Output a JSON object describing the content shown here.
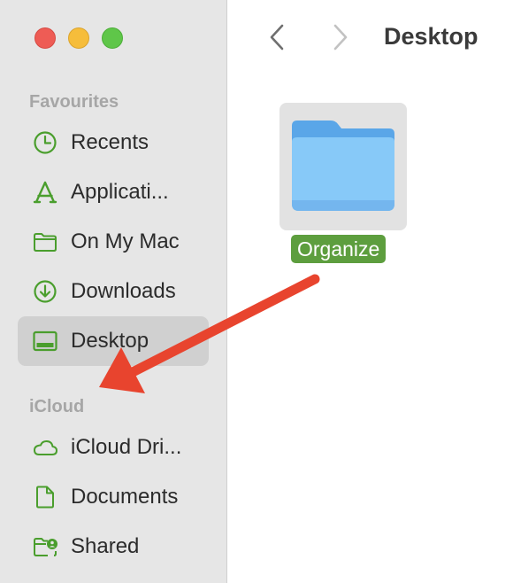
{
  "window": {
    "title": "Desktop",
    "traffic_lights": {
      "close": "#ee5c55",
      "minimize": "#f6bd3b",
      "zoom": "#5fc649"
    }
  },
  "colors": {
    "sidebar_icon": "#4a9e2d",
    "selection": "#d0d0d0",
    "folder": "#7ec4f7",
    "rename_highlight": "#5d9e3e",
    "annotation_arrow": "#e8442e"
  },
  "sidebar": {
    "favourites_label": "Favourites",
    "favourites": [
      {
        "label": "Recents",
        "icon": "clock-icon"
      },
      {
        "label": "Applicati...",
        "icon": "applications-icon"
      },
      {
        "label": "On My Mac",
        "icon": "folder-icon"
      },
      {
        "label": "Downloads",
        "icon": "download-icon"
      },
      {
        "label": "Desktop",
        "icon": "desktop-icon",
        "selected": true
      }
    ],
    "icloud_label": "iCloud",
    "icloud": [
      {
        "label": "iCloud Dri...",
        "icon": "cloud-icon"
      },
      {
        "label": "Documents",
        "icon": "document-icon"
      },
      {
        "label": "Shared",
        "icon": "shared-folder-icon"
      }
    ]
  },
  "content": {
    "items": [
      {
        "name": "Organize",
        "icon": "folder-icon",
        "selected": true
      }
    ]
  }
}
